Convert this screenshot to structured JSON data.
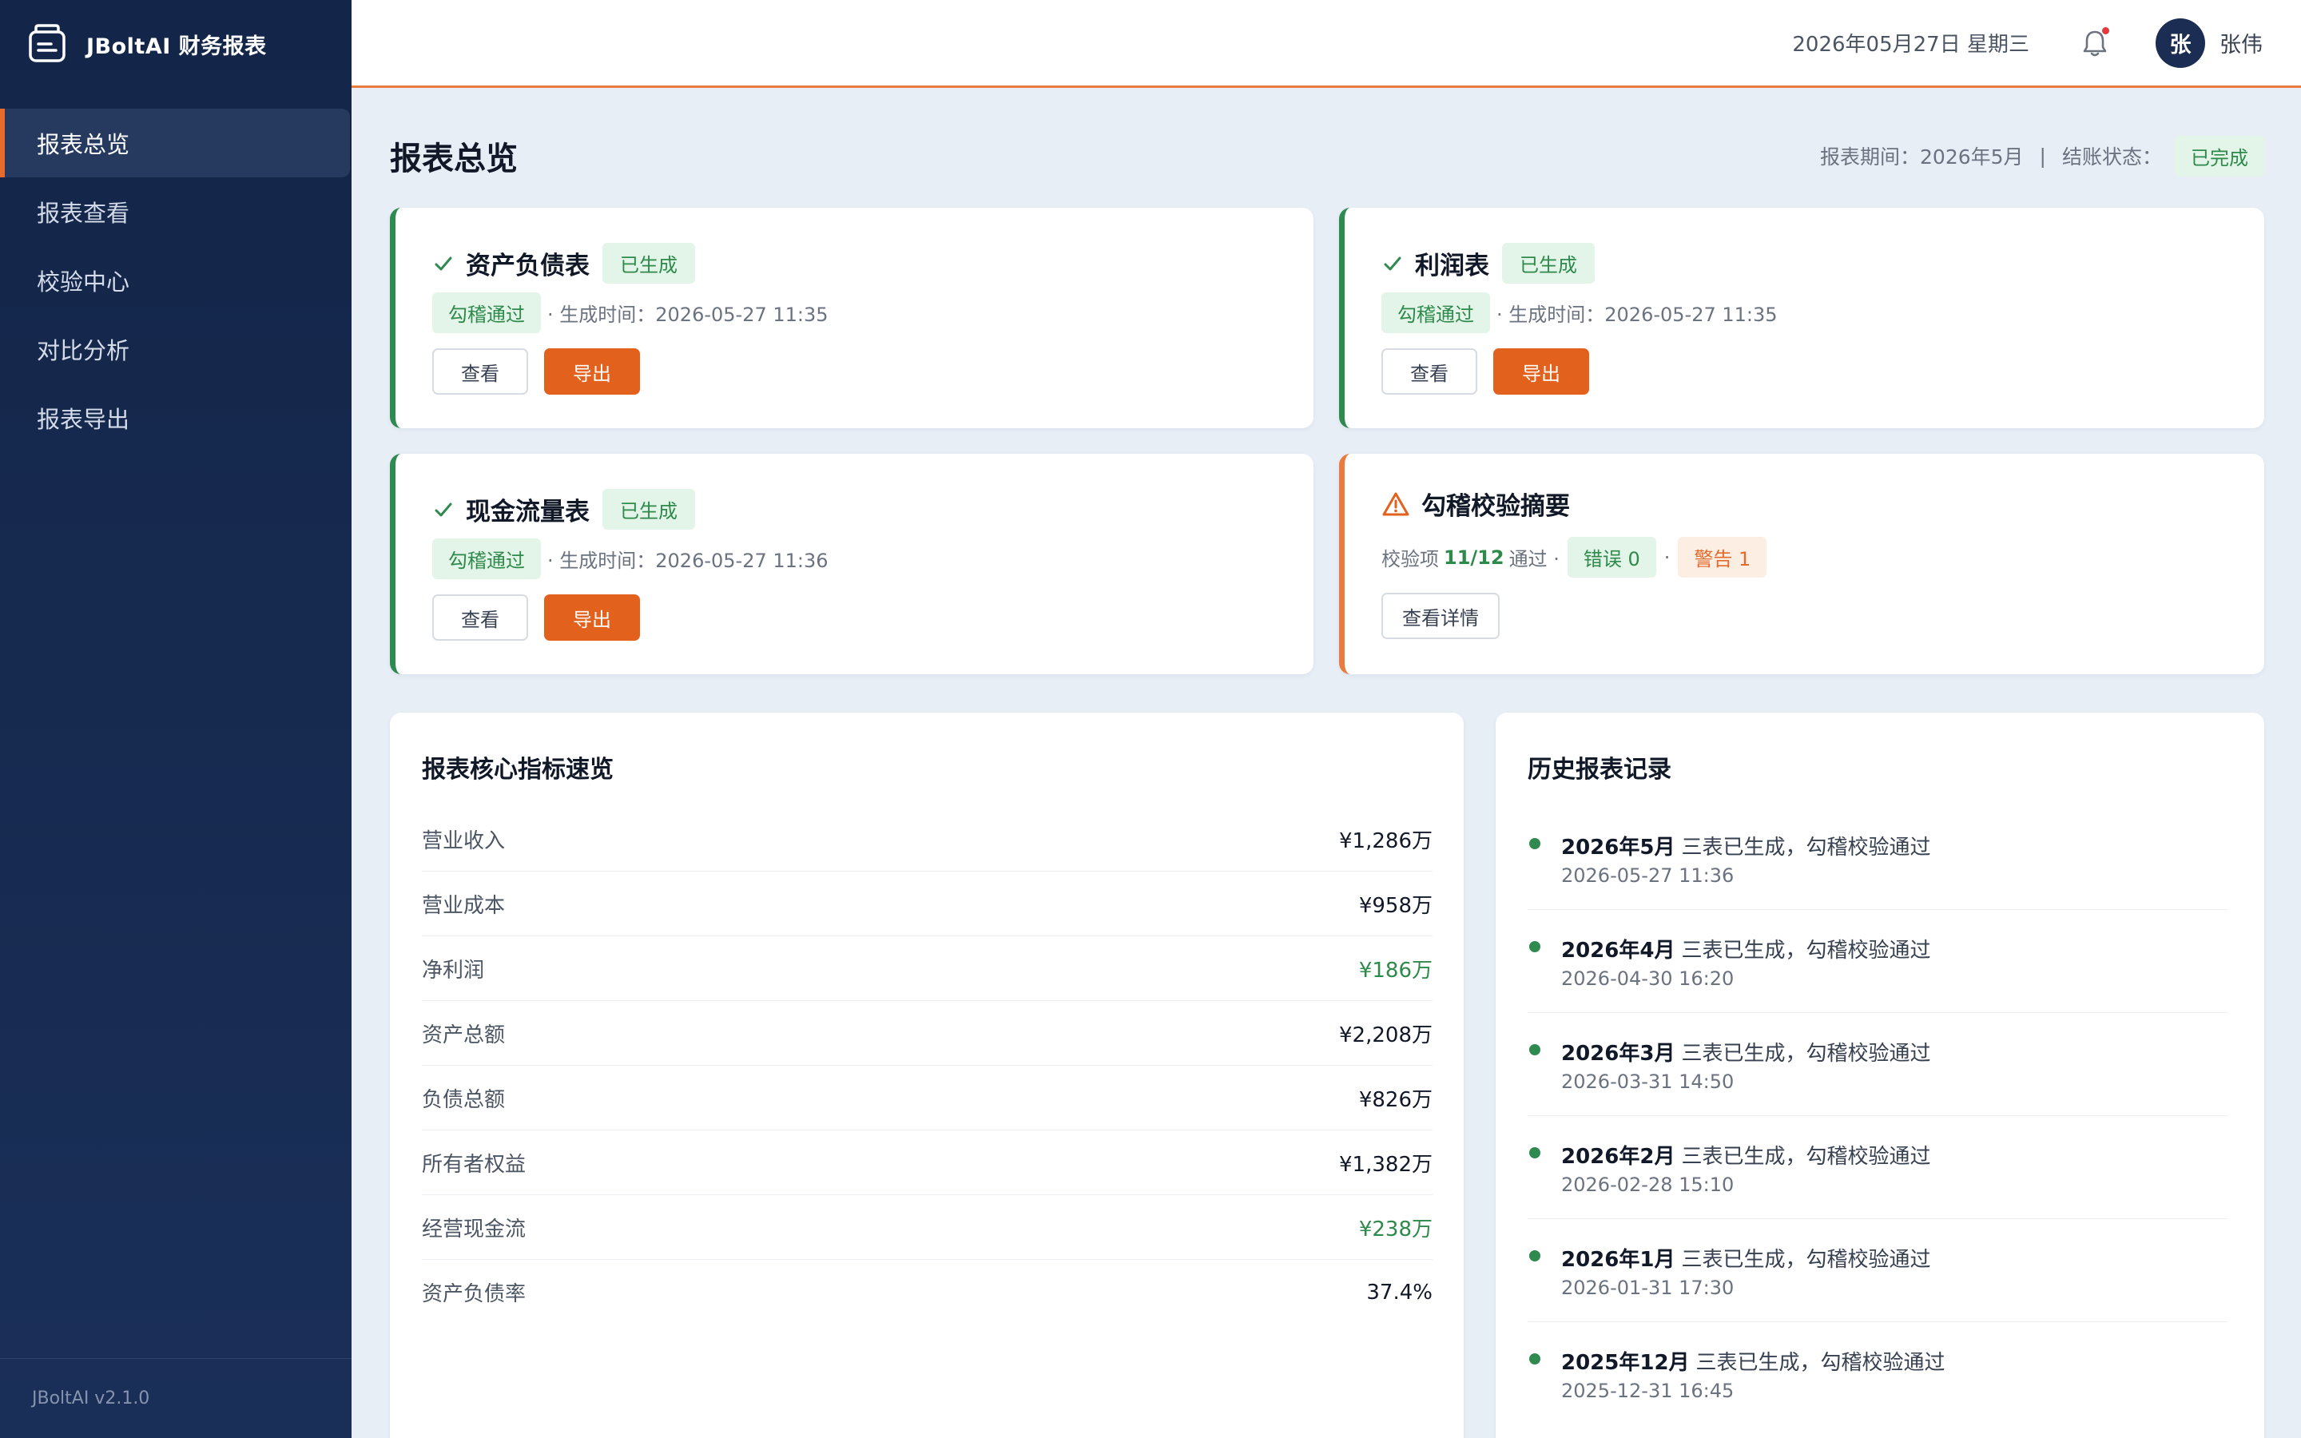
{
  "app": {
    "brand": "JBoltAI 财务报表",
    "version": "JBoltAI v2.1.0",
    "colors": {
      "accent": "#e2611d",
      "success": "#2e8a4b",
      "sidebar": "#132548"
    }
  },
  "sidebar": {
    "items": [
      {
        "label": "报表总览",
        "active": true
      },
      {
        "label": "报表查看"
      },
      {
        "label": "校验中心"
      },
      {
        "label": "对比分析"
      },
      {
        "label": "报表导出"
      }
    ]
  },
  "header": {
    "date": "2026年05月27日 星期三",
    "avatar_initial": "张",
    "user_name": "张伟",
    "icons": [
      "bell-icon"
    ]
  },
  "page": {
    "title": "报表总览",
    "period_label": "报表期间：",
    "period_value": "2026年5月",
    "separator": "|",
    "status_label": "结账状态：",
    "status_value": "已完成"
  },
  "report_cards": [
    {
      "title": "资产负债表",
      "status": "已生成",
      "check": "勾稽通过",
      "time_text": "· 生成时间：2026-05-27 11:35",
      "view": "查看",
      "export": "导出"
    },
    {
      "title": "利润表",
      "status": "已生成",
      "check": "勾稽通过",
      "time_text": "· 生成时间：2026-05-27 11:35",
      "view": "查看",
      "export": "导出"
    },
    {
      "title": "现金流量表",
      "status": "已生成",
      "check": "勾稽通过",
      "time_text": "· 生成时间：2026-05-27 11:36",
      "view": "查看",
      "export": "导出"
    }
  ],
  "summary_card": {
    "title": "勾稽校验摘要",
    "check_prefix": "校验项",
    "check_count": "11/12",
    "check_suffix": "通过 ·",
    "errors": "错误 0",
    "dot": "·",
    "warnings": "警告 1",
    "details_button": "查看详情"
  },
  "metrics": {
    "title": "报表核心指标速览",
    "rows": [
      {
        "label": "营业收入",
        "value": "¥1,286万"
      },
      {
        "label": "营业成本",
        "value": "¥958万"
      },
      {
        "label": "净利润",
        "value": "¥186万",
        "highlight": true
      },
      {
        "label": "资产总额",
        "value": "¥2,208万"
      },
      {
        "label": "负债总额",
        "value": "¥826万"
      },
      {
        "label": "所有者权益",
        "value": "¥1,382万"
      },
      {
        "label": "经营现金流",
        "value": "¥238万",
        "highlight": true
      },
      {
        "label": "资产负债率",
        "value": "37.4%"
      }
    ]
  },
  "history": {
    "title": "历史报表记录",
    "items": [
      {
        "period": "2026年5月",
        "desc": "三表已生成，勾稽校验通过",
        "time": "2026-05-27 11:36"
      },
      {
        "period": "2026年4月",
        "desc": "三表已生成，勾稽校验通过",
        "time": "2026-04-30 16:20"
      },
      {
        "period": "2026年3月",
        "desc": "三表已生成，勾稽校验通过",
        "time": "2026-03-31 14:50"
      },
      {
        "period": "2026年2月",
        "desc": "三表已生成，勾稽校验通过",
        "time": "2026-02-28 15:10"
      },
      {
        "period": "2026年1月",
        "desc": "三表已生成，勾稽校验通过",
        "time": "2026-01-31 17:30"
      },
      {
        "period": "2025年12月",
        "desc": "三表已生成，勾稽校验通过",
        "time": "2025-12-31 16:45"
      }
    ]
  }
}
